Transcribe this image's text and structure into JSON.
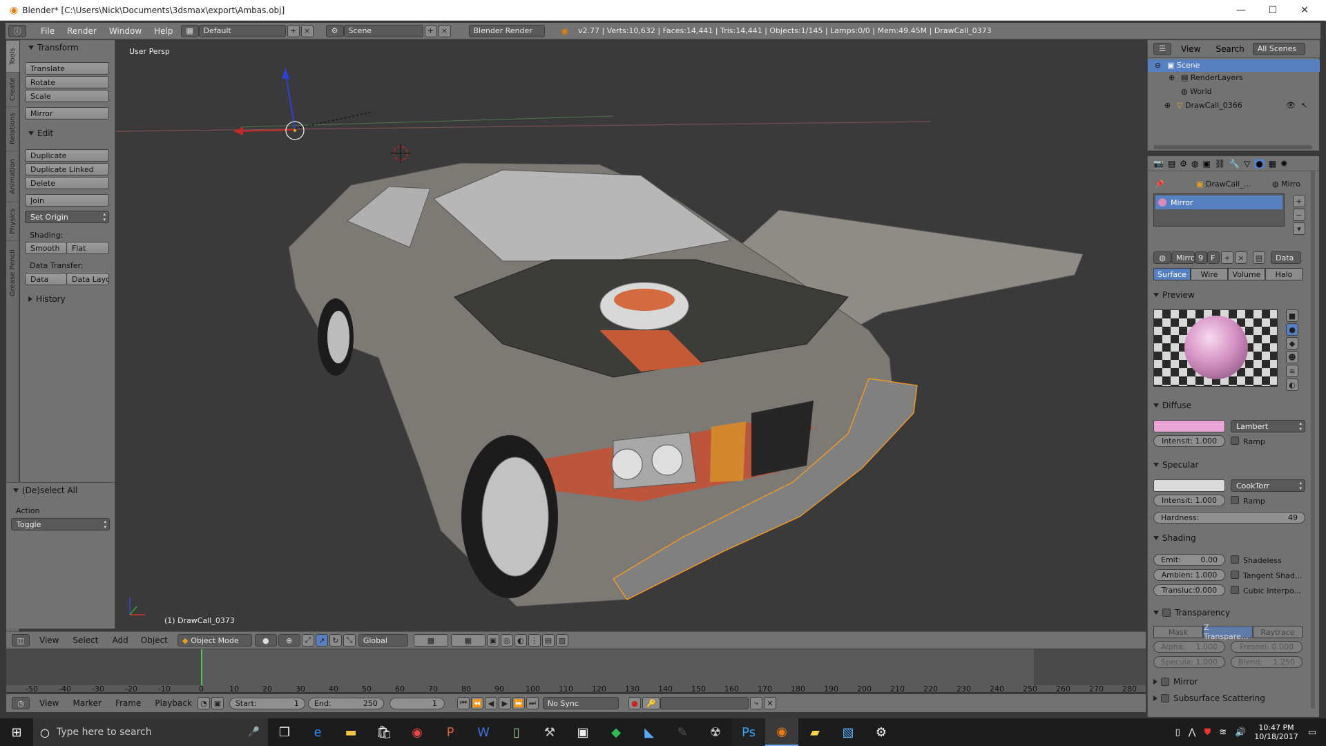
{
  "window": {
    "title": "Blender* [C:\\Users\\Nick\\Documents\\3dsmax\\export\\Ambas.obj]",
    "minimize": "—",
    "maximize": "☐",
    "close": "✕"
  },
  "topbar": {
    "menus": [
      "File",
      "Render",
      "Window",
      "Help"
    ],
    "layout": "Default",
    "scene": "Scene",
    "engine": "Blender Render",
    "stats": "v2.77 | Verts:10,632 | Faces:14,441 | Tris:14,441 | Objects:1/145 | Lamps:0/0 | Mem:49.45M | DrawCall_0373"
  },
  "tool_tabs": [
    "Tools",
    "Create",
    "Relations",
    "Animation",
    "Physics",
    "Grease Pencil"
  ],
  "toolshelf": {
    "transform_header": "Transform",
    "translate": "Translate",
    "rotate": "Rotate",
    "scale": "Scale",
    "mirror": "Mirror",
    "edit_header": "Edit",
    "duplicate": "Duplicate",
    "duplicate_linked": "Duplicate Linked",
    "delete": "Delete",
    "join": "Join",
    "set_origin": "Set Origin",
    "shading_label": "Shading:",
    "smooth": "Smooth",
    "flat": "Flat",
    "data_transfer_label": "Data Transfer:",
    "data": "Data",
    "data_layout": "Data Layo",
    "history_header": "History"
  },
  "operator": {
    "header": "(De)select All",
    "action_label": "Action",
    "action_value": "Toggle"
  },
  "viewport": {
    "view_name": "User Persp",
    "object_label": "(1) DrawCall_0373"
  },
  "viewport_header": {
    "view": "View",
    "select": "Select",
    "add": "Add",
    "object": "Object",
    "mode": "Object Mode",
    "orientation": "Global"
  },
  "timeline": {
    "ticks": [
      "-50",
      "-40",
      "-30",
      "-20",
      "-10",
      "0",
      "10",
      "20",
      "30",
      "40",
      "50",
      "60",
      "70",
      "80",
      "90",
      "100",
      "110",
      "120",
      "130",
      "140",
      "150",
      "160",
      "170",
      "180",
      "190",
      "200",
      "210",
      "220",
      "230",
      "240",
      "250",
      "260",
      "270",
      "280"
    ],
    "current_frame_marker": 0,
    "view": "View",
    "marker": "Marker",
    "frame": "Frame",
    "playback": "Playback",
    "start": "Start:",
    "start_val": "1",
    "end": "End:",
    "end_val": "250",
    "current": "1",
    "sync": "No Sync"
  },
  "outliner": {
    "view": "View",
    "search": "Search",
    "filter": "All Scenes",
    "items": [
      "Scene",
      "RenderLayers",
      "World",
      "DrawCall_0366"
    ]
  },
  "properties": {
    "breadcrumb_obj": "DrawCall_...",
    "breadcrumb_mat": "Mirro",
    "slot_name": "Mirror",
    "mat_name": "Mirro",
    "users": "9",
    "fake": "F",
    "data_btn": "Data",
    "tabs": [
      "Surface",
      "Wire",
      "Volume",
      "Halo"
    ],
    "preview": "Preview",
    "diffuse": "Diffuse",
    "diffuse_shader": "Lambert",
    "diffuse_color": "#e9a5d8",
    "diffuse_intensity": "Intensit: 1.000",
    "ramp": "Ramp",
    "specular": "Specular",
    "specular_shader": "CookTorr",
    "specular_intensity": "Intensit: 1.000",
    "hardness_label": "Hardness:",
    "hardness": "49",
    "shading": "Shading",
    "emit": "Emit:",
    "emit_val": "0.00",
    "ambient": "Ambien: 1.000",
    "translucency": "Transluc:0.000",
    "shadeless": "Shadeless",
    "tangent": "Tangent Shad...",
    "cubic": "Cubic Interpo...",
    "transparency": "Transparency",
    "trans_modes": [
      "Mask",
      "Z Transpare...",
      "Raytrace"
    ],
    "alpha": "Alpha:",
    "alpha_val": "1.000",
    "fresnel": "Fresnel: 0.000",
    "specular_t": "Specula: 1.000",
    "blend": "Blend:",
    "blend_val": "1.250",
    "mirror": "Mirror",
    "sss": "Subsurface Scattering"
  },
  "taskbar": {
    "search": "Type here to search",
    "time": "10:47 PM",
    "date": "10/18/2017"
  }
}
